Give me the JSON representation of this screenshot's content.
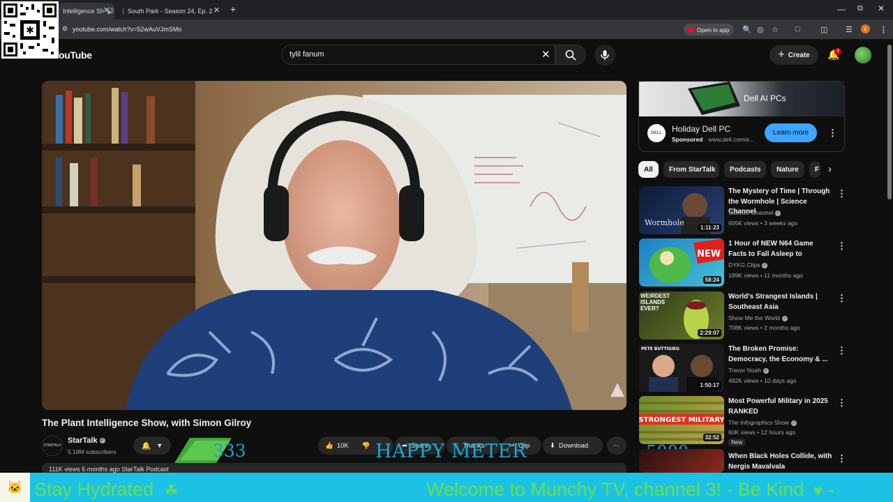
{
  "browser": {
    "tabs": [
      {
        "label": "Intelligence Sh"
      },
      {
        "label": "South Park - Season 24, Ep. 2 -"
      }
    ],
    "url": "youtube.com/watch?v=52wAuVJmSMo",
    "open_in_app": "Open in app",
    "profile_initial": "c"
  },
  "header": {
    "logo": "YouTube",
    "search_value": "tylil fanum",
    "create_label": "Create",
    "notification_count": "3"
  },
  "video": {
    "title": "The Plant Intelligence Show, with Simon Gilroy",
    "channel": "StarTalk",
    "channel_avatar_text": "STARTALK",
    "subscribers": "5.18M subscribers",
    "likes": "10K",
    "share_label": "Share",
    "thanks_label": "Thanks",
    "clip_label": "Clip",
    "download_label": "Download",
    "description_preview": "111K views  6 months ago   StarTalk Podcast"
  },
  "overlay": {
    "meter_value": "333",
    "meter_label": "HAPPY METER",
    "goal_value": "5000",
    "ticker_left": "Stay Hydrated",
    "ticker_right": "Welcome to Munchy TV, channel 3!  - Be Kind",
    "colors": {
      "ticker_bg": "#1cc2e5",
      "ticker_text": "#66e04f",
      "meter_text": "#17a7d6"
    }
  },
  "ad": {
    "banner_text": "Dell AI PCs",
    "logo_text": "DELL",
    "title": "Holiday Dell PC",
    "sponsored": "Sponsored",
    "url": "www.dell.com/e...",
    "cta": "Learn more"
  },
  "chips": [
    {
      "label": "All"
    },
    {
      "label": "From StarTalk"
    },
    {
      "label": "Podcasts"
    },
    {
      "label": "Nature"
    },
    {
      "label": "F"
    }
  ],
  "recommendations": [
    {
      "title": "The Mystery of Time | Through the Wormhole | Science Channel",
      "channel": "Science Channel",
      "meta": "695K views • 3 weeks ago",
      "duration": "1:11:23",
      "thumb_text": "Wormhole"
    },
    {
      "title": "1 Hour of NEW N64 Game Facts to Fall Asleep to",
      "channel": "DYKG Clips",
      "meta": "189K views • 11 months ago",
      "duration": "58:24",
      "thumb_text": "NEW"
    },
    {
      "title": "World's Strangest Islands | Southeast Asia",
      "channel": "Show Me the World",
      "meta": "708K views • 2 months ago",
      "duration": "2:29:07",
      "thumb_text": "WEIRDEST ISLANDS EVER?"
    },
    {
      "title": "The Broken Promise: Democracy, the Economy & ...",
      "channel": "Trevor Noah",
      "meta": "492K views • 10 days ago",
      "duration": "1:50:17",
      "thumb_text": "PETE BUTTIGIEG"
    },
    {
      "title": "Most Powerful Military in 2025 RANKED",
      "channel": "The Infographics Show",
      "meta": "60K views • 12 hours ago",
      "duration": "32:52",
      "thumb_text": "STRONGEST MILITARY",
      "badge": "New"
    },
    {
      "title": "When Black Holes Collide, with Nergis Mavalvala",
      "channel": "",
      "meta": "",
      "duration": "",
      "thumb_text": ""
    }
  ]
}
